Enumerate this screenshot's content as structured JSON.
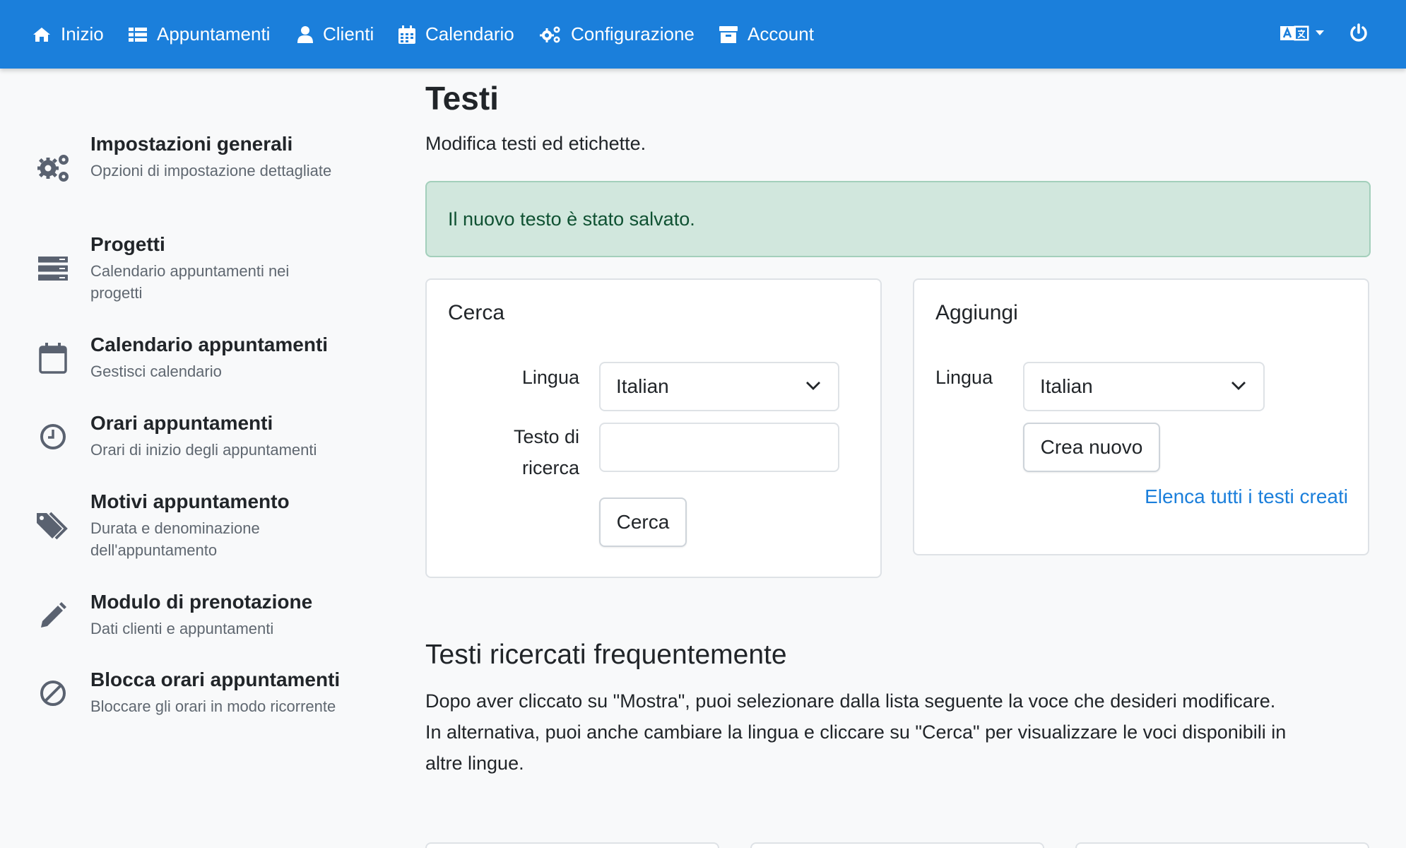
{
  "nav": {
    "items": [
      {
        "label": "Inizio",
        "icon": "home-icon"
      },
      {
        "label": "Appuntamenti",
        "icon": "list-icon"
      },
      {
        "label": "Clienti",
        "icon": "user-icon"
      },
      {
        "label": "Calendario",
        "icon": "calendar-icon"
      },
      {
        "label": "Configurazione",
        "icon": "gears-icon"
      },
      {
        "label": "Account",
        "icon": "archive-icon"
      }
    ],
    "language_icon": "language-icon",
    "power_icon": "power-icon",
    "color": "#1b7fdb"
  },
  "sidebar": {
    "items": [
      {
        "title": "Impostazioni generali",
        "desc": "Opzioni di impostazione dettagliate",
        "icon": "gears-icon"
      },
      {
        "title": "Progetti",
        "desc": "Calendario appuntamenti nei progetti",
        "icon": "server-icon"
      },
      {
        "title": "Calendario appuntamenti",
        "desc": "Gestisci calendario",
        "icon": "calendar-icon"
      },
      {
        "title": "Orari appuntamenti",
        "desc": "Orari di inizio degli appuntamenti",
        "icon": "clock-icon"
      },
      {
        "title": "Motivi appuntamento",
        "desc": "Durata e denominazione dell'appuntamento",
        "icon": "tags-icon"
      },
      {
        "title": "Modulo di prenotazione",
        "desc": "Dati clienti e appuntamenti",
        "icon": "pencil-icon"
      },
      {
        "title": "Blocca orari appuntamenti",
        "desc": "Bloccare gli orari in modo ricorrente",
        "icon": "ban-icon"
      }
    ]
  },
  "main": {
    "title": "Testi",
    "lead": "Modifica testi ed etichette.",
    "alert": "Il nuovo testo è stato salvato.",
    "alert_color": "#d1e7dd",
    "search_card": {
      "title": "Cerca",
      "language_label": "Lingua",
      "language_value": "Italian",
      "search_label_line1": "Testo di",
      "search_label_line2": "ricerca",
      "search_value": "",
      "button": "Cerca"
    },
    "add_card": {
      "title": "Aggiungi",
      "language_label": "Lingua",
      "language_value": "Italian",
      "button": "Crea nuovo",
      "link": "Elenca tutti i testi creati"
    },
    "frequent": {
      "title": "Testi ricercati frequentemente",
      "line1": "Dopo aver cliccato su \"Mostra\", puoi selezionare dalla lista seguente la voce che desideri modificare.",
      "line2": "In alternativa, puoi anche cambiare la lingua e cliccare su \"Cerca\" per visualizzare le voci disponibili in",
      "line3": "altre lingue."
    }
  }
}
